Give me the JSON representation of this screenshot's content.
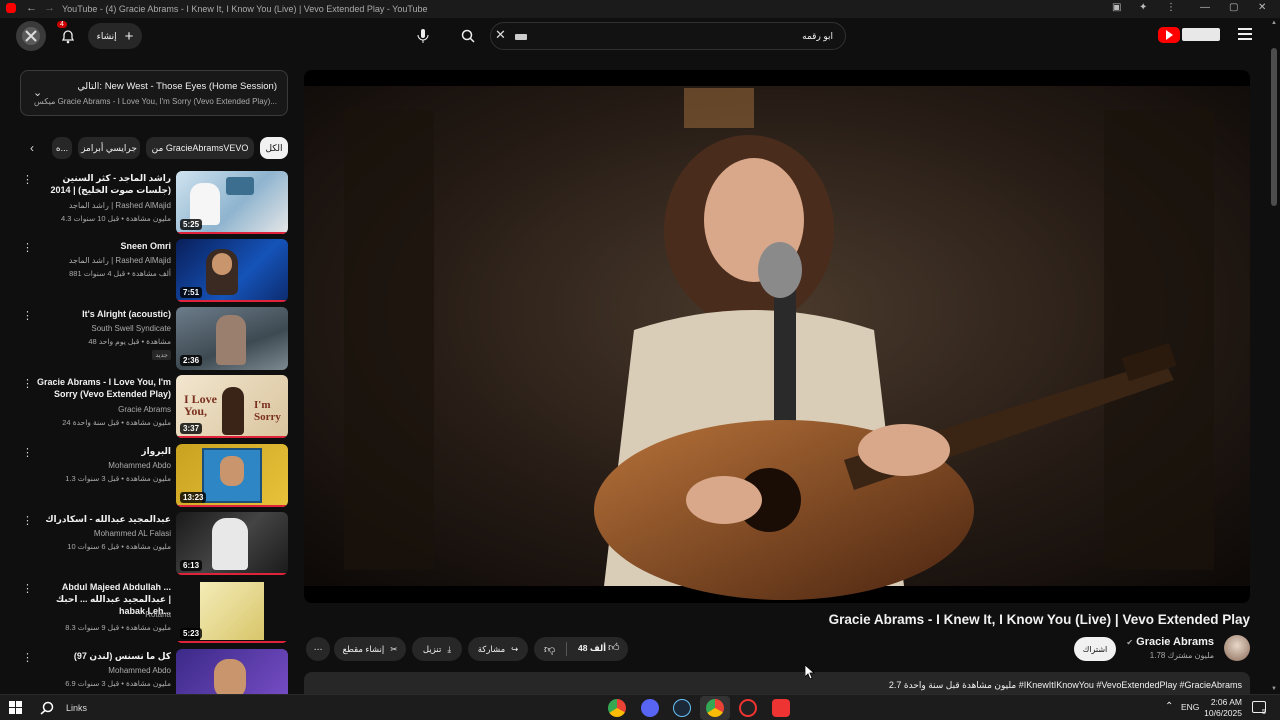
{
  "window": {
    "title": "YouTube - (4) Gracie Abrams - I Knew It, I Know You (Live) | Vevo Extended Play - YouTube"
  },
  "masthead": {
    "create_label": "إنشاء",
    "notification_count": "4",
    "search_query": "ابو رقمه",
    "logo_text": "YouTube"
  },
  "up_next": {
    "line1": "التالي: New West - Those Eyes (Home Session)",
    "line2": "ميكس Gracie Abrams - I Love You, I'm Sorry (Vevo Extended Play)..."
  },
  "chips": {
    "all": "الكل",
    "from_channel": "من GracieAbramsVEVO",
    "gracie": "جرايسي أبرامز",
    "more": "ه..."
  },
  "recommendations": [
    {
      "title": "راشد الماجد - كثر السنين (جلسات صوت الخليج) | 2014",
      "channel": "راشد الماجد | Rashed AlMajid",
      "meta": "4.3 مليون مشاهدة • قبل 10 سنوات",
      "duration": "5:25"
    },
    {
      "title": "Sneen Omri",
      "channel": "راشد الماجد | Rashed AlMajid",
      "meta": "881 ألف مشاهدة • قبل 4 سنوات",
      "duration": "7:51"
    },
    {
      "title": "It's Alright (acoustic)",
      "channel": "South Swell Syndicate",
      "meta": "48 مشاهدة • قبل يوم واحد",
      "badge": "جديد",
      "duration": "2:36"
    },
    {
      "title": "Gracie Abrams - I Love You, I'm Sorry (Vevo Extended Play)",
      "channel": "Gracie Abrams",
      "meta": "24 مليون مشاهدة • قبل سنة واحدة",
      "duration": "3:37"
    },
    {
      "title": "البرواز",
      "channel": "Mohammed Abdo",
      "meta": "1.3 مليون مشاهدة • قبل 3 سنوات",
      "duration": "13:23"
    },
    {
      "title": "عبدالمجيد عبدالله - اسكادراك",
      "channel": "Mohammed AL Falasi",
      "meta": "10 مليون مشاهدة • قبل 6 سنوات",
      "duration": "6:13"
    },
    {
      "title": "Abdul Majeed Abdullah ... عبدالمجيد عبدالله ... احبك | habak Leh...",
      "channel": "Rotana",
      "meta": "8.3 مليون مشاهدة • قبل 9 سنوات",
      "duration": "5:23"
    },
    {
      "title": "كل ما نسنس (لندن 97)",
      "channel": "Mohammed Abdo",
      "meta": "6.9 مليون مشاهدة • قبل 3 سنوات",
      "duration": ""
    }
  ],
  "video": {
    "title": "Gracie Abrams - I Knew It, I Know You (Live) | Vevo Extended Play",
    "channel": "Gracie Abrams",
    "subscribers": "1.78 مليون مشترك",
    "subscribe_label": "اشتراك",
    "likes": "48 ألف",
    "share_label": "مشاركة",
    "download_label": "تنزيل",
    "clip_label": "إنشاء مقطع",
    "description": "2.7 مليون مشاهدة قبل سنة واحدة #IKnewItIKnowYou #VevoExtendedPlay #GracieAbrams"
  },
  "taskbar": {
    "search_label": "Links",
    "language": "ENG",
    "time": "2:06 AM",
    "date": "10/6/2025",
    "notification_count": "5"
  },
  "colors": {
    "background": "#0f0f0f",
    "youtube_red": "#ff0000",
    "progress_red": "#e0233b"
  }
}
